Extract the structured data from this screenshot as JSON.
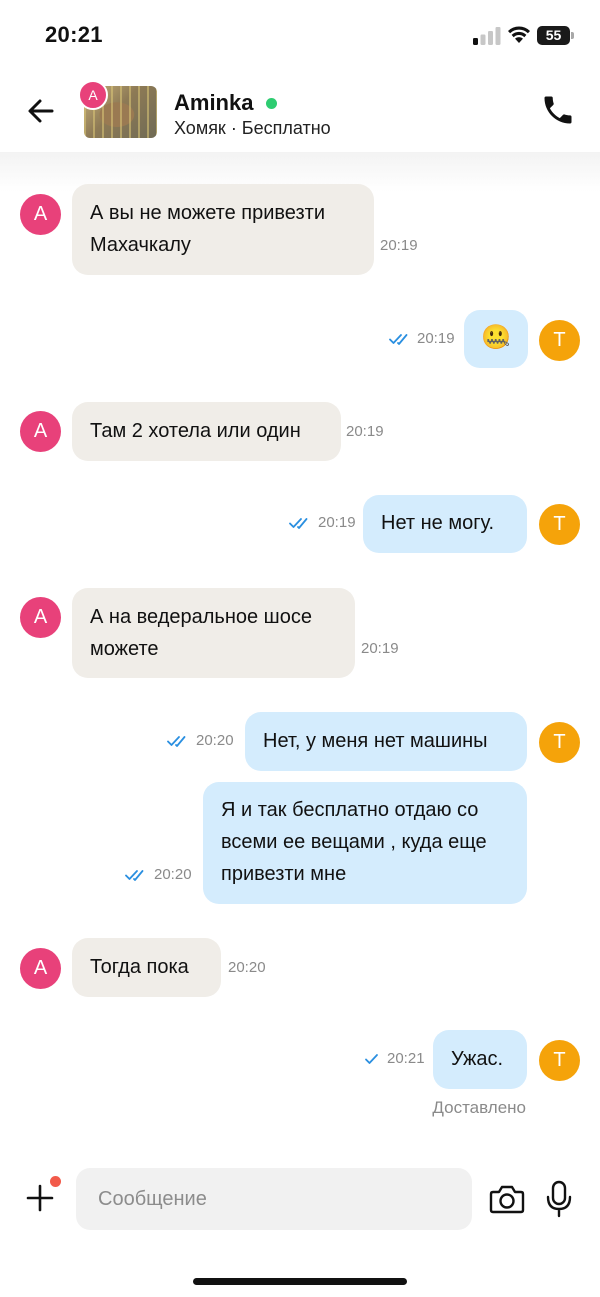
{
  "status_bar": {
    "time": "20:21",
    "battery": "55"
  },
  "header": {
    "avatar_letter": "A",
    "contact_name": "Aminka",
    "listing_subtitle": "Хомяк · Бесплатно"
  },
  "chat": {
    "messages": [
      {
        "side": "in",
        "avatar": "A",
        "lines": [
          "А вы  не можете привезти",
          "Махачкалу"
        ],
        "time": "20:19"
      },
      {
        "side": "out",
        "avatar": "T",
        "emoji": "🤐",
        "time": "20:19",
        "status": "read"
      },
      {
        "side": "in",
        "avatar": "A",
        "lines": [
          "Там 2 хотела или один"
        ],
        "time": "20:19"
      },
      {
        "side": "out",
        "avatar": "T",
        "lines": [
          "Нет не могу."
        ],
        "time": "20:19",
        "status": "read"
      },
      {
        "side": "in",
        "avatar": "A",
        "lines": [
          "А на ведеральное шосе",
          "можете"
        ],
        "time": "20:19"
      },
      {
        "side": "out",
        "avatar": "T",
        "lines": [
          "Нет, у меня нет машины"
        ],
        "time": "20:20",
        "status": "read"
      },
      {
        "side": "out",
        "lines": [
          "Я и так бесплатно отдаю со",
          "всеми ее вещами , куда еще",
          "привезти мне"
        ],
        "time": "20:20",
        "status": "read"
      },
      {
        "side": "in",
        "avatar": "A",
        "lines": [
          "Тогда пока"
        ],
        "time": "20:20"
      },
      {
        "side": "out",
        "avatar": "T",
        "lines": [
          "Ужас."
        ],
        "time": "20:21",
        "status": "sent"
      }
    ],
    "delivered_label": "Доставлено"
  },
  "input": {
    "placeholder": "Сообщение"
  },
  "colors": {
    "incoming_bubble": "#f0ede8",
    "outgoing_bubble": "#d4ecfd",
    "avatar_a": "#e8417a",
    "avatar_t": "#f5a30a",
    "online": "#2ecc71",
    "check": "#2a8fe0"
  },
  "icons": [
    "back-arrow-icon",
    "phone-icon",
    "plus-icon",
    "camera-icon",
    "microphone-icon",
    "double-check-icon",
    "single-check-icon",
    "wifi-icon",
    "signal-icon",
    "battery-icon"
  ]
}
